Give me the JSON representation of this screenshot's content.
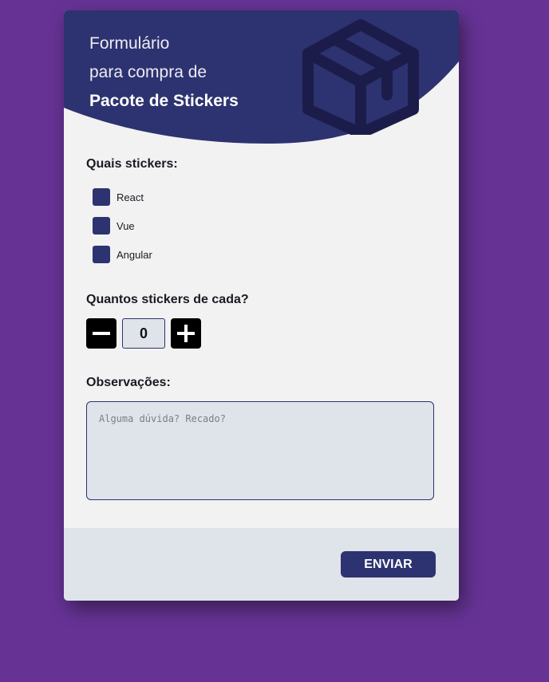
{
  "header": {
    "title_line1": "Formulário",
    "title_line2": "para compra de",
    "title_strong": "Pacote de Stickers",
    "icon": "package-box-icon"
  },
  "stickers": {
    "label": "Quais stickers:",
    "options": [
      {
        "label": "React",
        "checked": false
      },
      {
        "label": "Vue",
        "checked": false
      },
      {
        "label": "Angular",
        "checked": false
      }
    ]
  },
  "quantity": {
    "label": "Quantos stickers de cada?",
    "value": "0",
    "decrement_icon": "minus-icon",
    "increment_icon": "plus-icon"
  },
  "notes": {
    "label": "Observações:",
    "placeholder": "Alguma dúvida? Recado?",
    "value": ""
  },
  "footer": {
    "submit_label": "ENVIAR"
  },
  "colors": {
    "page_background": "#663395",
    "card_background": "#f2f2f2",
    "header_navy": "#2d3270",
    "icon_dark": "#1c1c4a",
    "footer_background": "#dfe3ea",
    "button_black": "#000000"
  }
}
